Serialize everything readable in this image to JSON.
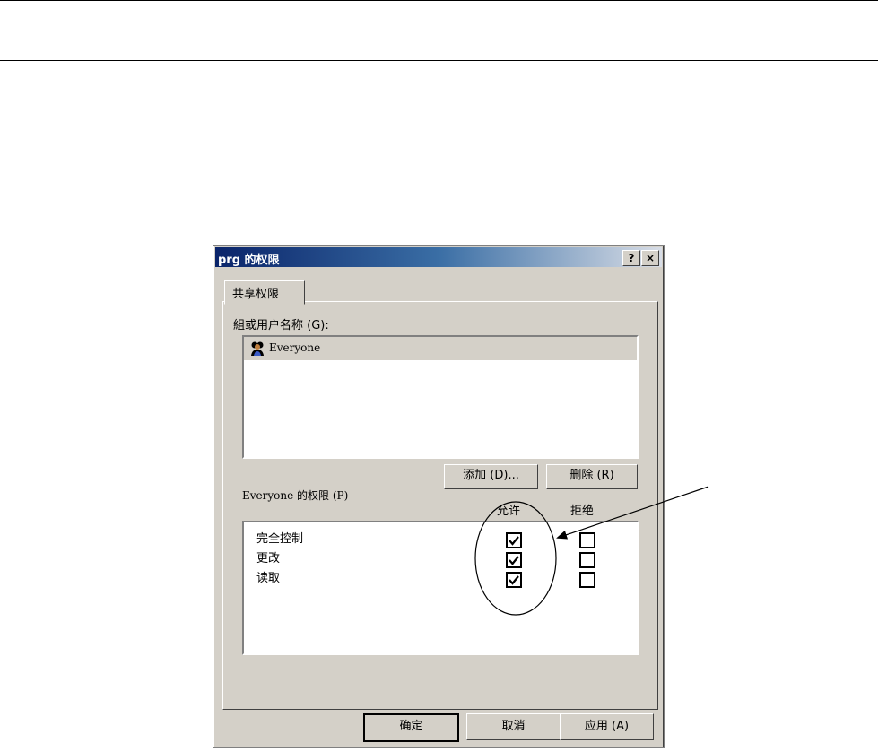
{
  "dialog": {
    "title": "prg 的权限",
    "help_button": "?",
    "close_button": "×",
    "tab_label": "共享权限",
    "groups_label": "組或用户名称 (G):",
    "groups": [
      {
        "name": "Everyone",
        "icon": "user-group-icon",
        "selected": true
      }
    ],
    "add_button": "添加 (D)...",
    "remove_button": "删除 (R)",
    "permissions_label": "Everyone 的权限 (P)",
    "allow_header": "允许",
    "deny_header": "拒绝",
    "permissions": [
      {
        "name": "完全控制",
        "allow": true,
        "deny": false
      },
      {
        "name": "更改",
        "allow": true,
        "deny": false
      },
      {
        "name": "读取",
        "allow": true,
        "deny": false
      }
    ],
    "ok_button": "确定",
    "cancel_button": "取消",
    "apply_button": "应用 (A)"
  }
}
